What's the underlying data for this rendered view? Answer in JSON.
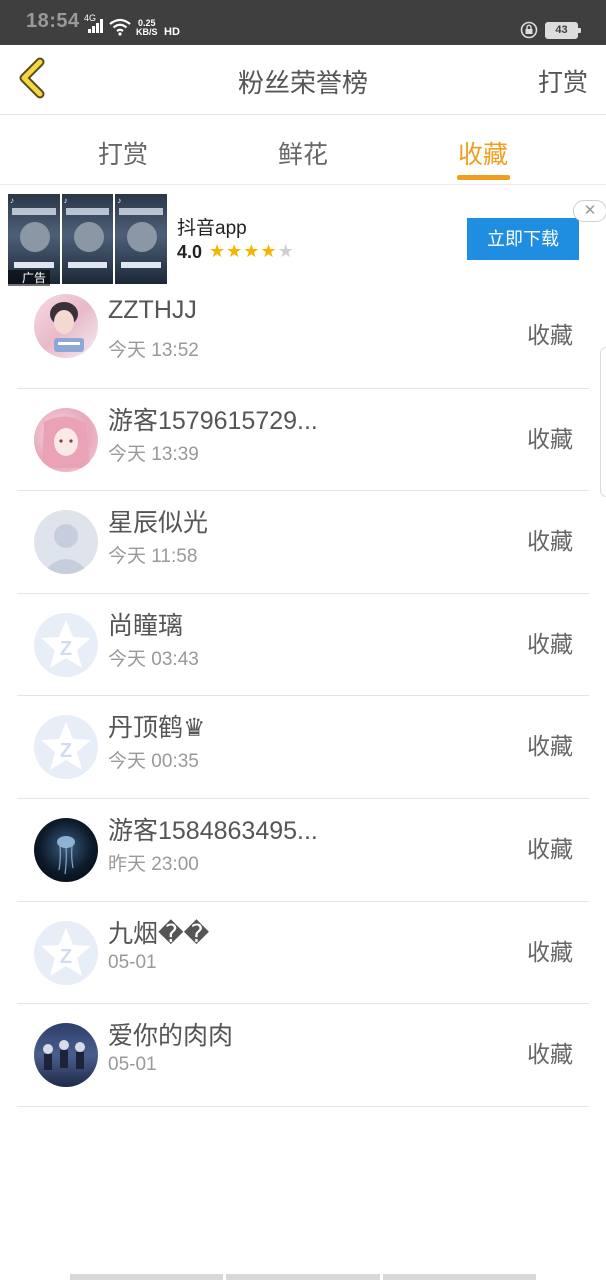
{
  "status_bar": {
    "time": "18:54",
    "network": "4G",
    "speed_value": "0.25",
    "speed_unit": "KB/S",
    "hd": "HD",
    "battery": "43"
  },
  "header": {
    "title": "粉丝荣誉榜",
    "action": "打赏"
  },
  "tabs": [
    {
      "label": "打赏",
      "active": false
    },
    {
      "label": "鲜花",
      "active": false
    },
    {
      "label": "收藏",
      "active": true
    }
  ],
  "colors": {
    "accent": "#f0a020",
    "download_button": "#1f8ee0",
    "star": "#f5b400"
  },
  "ad": {
    "label": "广告",
    "app_name": "抖音app",
    "rating": "4.0",
    "stars_filled": 4,
    "stars_total": 5,
    "download_label": "立即下载",
    "close_icon": "close-icon"
  },
  "list": [
    {
      "name": "ZZTHJJ",
      "time": "今天 13:52",
      "action": "收藏",
      "avatar": "photo-avatar"
    },
    {
      "name": "游客1579615729...",
      "time": "今天 13:39",
      "action": "收藏",
      "avatar": "anime-avatar"
    },
    {
      "name": "星辰似光",
      "time": "今天 11:58",
      "action": "收藏",
      "avatar": "default-person-avatar"
    },
    {
      "name": "尚瞳璃",
      "time": "今天 03:43",
      "action": "收藏",
      "avatar": "qq-star-avatar"
    },
    {
      "name": "丹顶鹤♛",
      "time": "今天 00:35",
      "action": "收藏",
      "avatar": "qq-star-avatar"
    },
    {
      "name": "游客1584863495...",
      "time": "昨天 23:00",
      "action": "收藏",
      "avatar": "jellyfish-avatar"
    },
    {
      "name": "九烟��",
      "time": "05-01",
      "action": "收藏",
      "avatar": "qq-star-avatar"
    },
    {
      "name": "爱你的肉肉",
      "time": "05-01",
      "action": "收藏",
      "avatar": "group-photo-avatar"
    }
  ]
}
